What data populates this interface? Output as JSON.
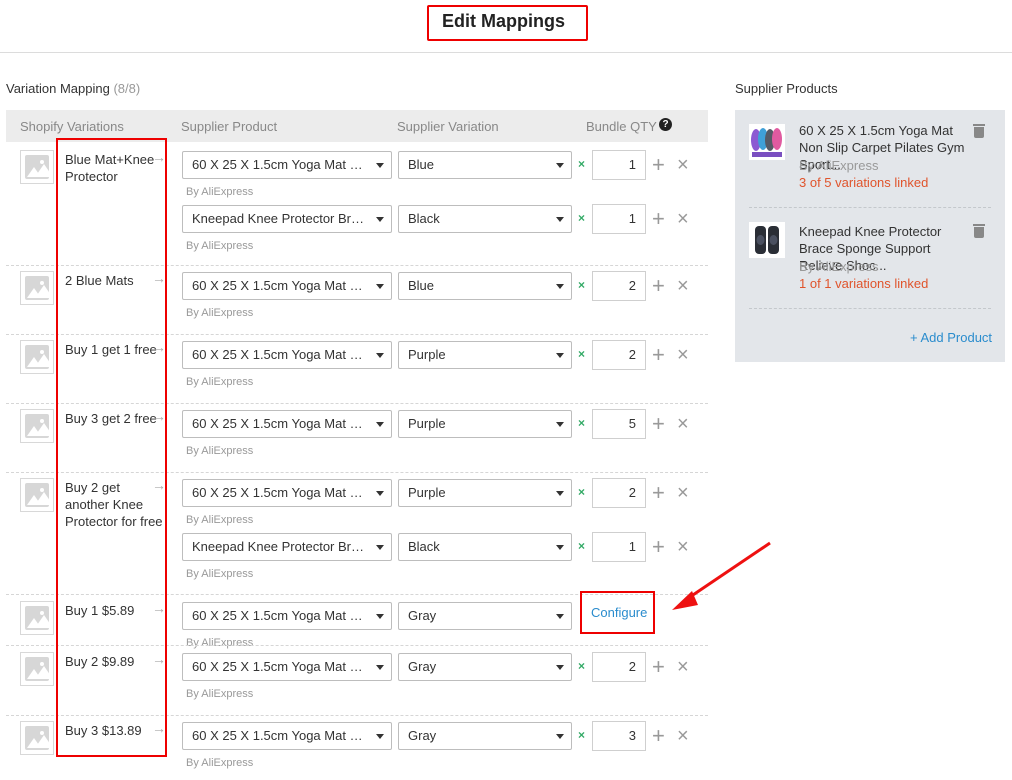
{
  "page": {
    "title": "Edit Mappings"
  },
  "mapping": {
    "section_title": "Variation Mapping",
    "section_count": "(8/8)",
    "headers": {
      "shopify": "Shopify Variations",
      "supplier_product": "Supplier Product",
      "supplier_variation": "Supplier Variation",
      "bundle_qty": "Bundle QTY"
    },
    "by_label": "By AliExpress",
    "times": "×",
    "rows": [
      {
        "label": "Blue Mat+Knee Protector",
        "lines": [
          {
            "product": "60 X 25 X 1.5cm Yoga Mat No...",
            "variation": "Blue",
            "qty": "1"
          },
          {
            "product": "Kneepad Knee Protector Brace ...",
            "variation": "Black",
            "qty": "1"
          }
        ]
      },
      {
        "label": "2 Blue Mats",
        "lines": [
          {
            "product": "60 X 25 X 1.5cm Yoga Mat No...",
            "variation": "Blue",
            "qty": "2"
          }
        ]
      },
      {
        "label": "Buy 1 get 1 free",
        "lines": [
          {
            "product": "60 X 25 X 1.5cm Yoga Mat No...",
            "variation": "Purple",
            "qty": "2"
          }
        ]
      },
      {
        "label": "Buy 3 get 2 free",
        "lines": [
          {
            "product": "60 X 25 X 1.5cm Yoga Mat No...",
            "variation": "Purple",
            "qty": "5"
          }
        ]
      },
      {
        "label": "Buy 2 get another Knee Protector for free",
        "lines": [
          {
            "product": "60 X 25 X 1.5cm Yoga Mat No...",
            "variation": "Purple",
            "qty": "2"
          },
          {
            "product": "Kneepad Knee Protector Brace ...",
            "variation": "Black",
            "qty": "1"
          }
        ]
      },
      {
        "label": "Buy 1 $5.89",
        "lines": [
          {
            "product": "60 X 25 X 1.5cm Yoga Mat No...",
            "variation": "Gray",
            "configure": "Configure"
          }
        ]
      },
      {
        "label": "Buy 2 $9.89",
        "lines": [
          {
            "product": "60 X 25 X 1.5cm Yoga Mat No...",
            "variation": "Gray",
            "qty": "2"
          }
        ]
      },
      {
        "label": "Buy 3 $13.89",
        "lines": [
          {
            "product": "60 X 25 X 1.5cm Yoga Mat No...",
            "variation": "Gray",
            "qty": "3"
          }
        ]
      }
    ]
  },
  "sidebar": {
    "title": "Supplier Products",
    "products": [
      {
        "name": "60 X 25 X 1.5cm Yoga Mat Non Slip Carpet Pilates Gym Sport...",
        "by": "By AliExpress",
        "linked": "3 of 5 variations linked"
      },
      {
        "name": "Kneepad Knee Protector Brace Sponge Support Relieve Shoc...",
        "by": "By AliExpress",
        "linked": "1 of 1 variations linked"
      }
    ],
    "add_product": "+ Add Product"
  },
  "colors": {
    "accent": "#2a8ccd",
    "linked_text": "#e0542c",
    "annotation": "#ee0000"
  }
}
